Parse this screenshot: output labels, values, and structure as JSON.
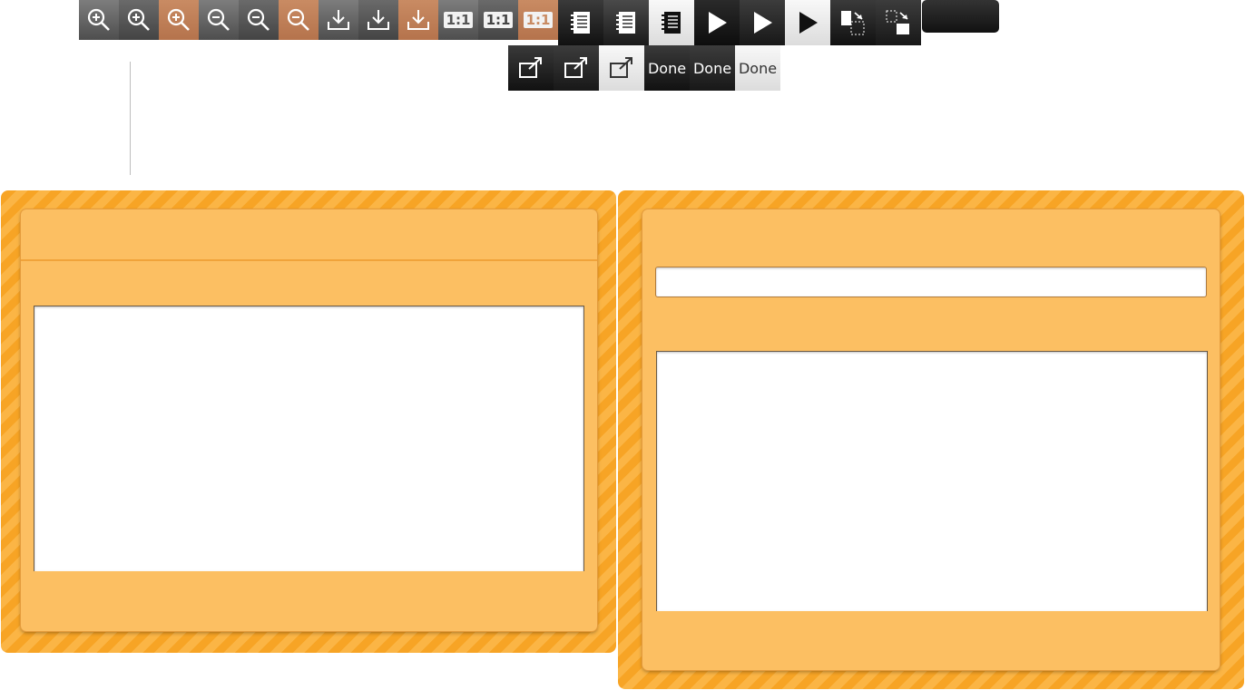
{
  "toolbar": {
    "ratio_label": "1:1",
    "done_label": "Done",
    "icons": [
      "zoom-in-icon",
      "zoom-out-icon",
      "download-icon",
      "ratio-icon",
      "notebook-icon",
      "play-icon",
      "swap-icon",
      "external-link-icon"
    ]
  },
  "panels": {
    "left": {
      "title": ""
    },
    "right": {
      "title": "",
      "input_value": ""
    }
  },
  "colors": {
    "stripe_a": "#f7a425",
    "stripe_b": "#fbb545",
    "panel_bg": "#fcbf62",
    "accent_orange": "#c98b63"
  }
}
